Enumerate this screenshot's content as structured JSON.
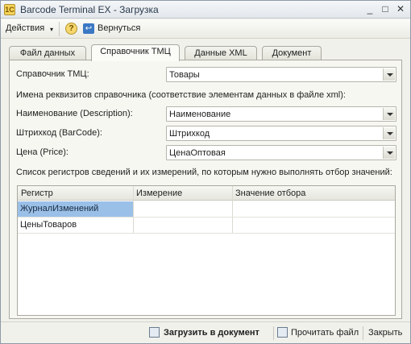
{
  "window": {
    "title": "Barcode Terminal EX - Загрузка",
    "minimize": "_",
    "maximize": "□",
    "close": "✕",
    "app_icon": "1C"
  },
  "toolbar": {
    "actions_label": "Действия",
    "actions_arrow": "▾",
    "help_icon": "?",
    "back_icon": "↩",
    "back_label": "Вернуться"
  },
  "tabs": [
    {
      "label": "Файл данных"
    },
    {
      "label": "Справочник ТМЦ"
    },
    {
      "label": "Данные XML"
    },
    {
      "label": "Документ"
    }
  ],
  "form": {
    "catalog_label": "Справочник ТМЦ:",
    "catalog_value": "Товары",
    "fields_header": "Имена реквизитов справочника (соответствие элементам данных в файле xml):",
    "name_label": "Наименование (Description):",
    "name_value": "Наименование",
    "barcode_label": "Штрихкод (BarCode):",
    "barcode_value": "Штрихкод",
    "price_label": "Цена (Price):",
    "price_value": "ЦенаОптовая",
    "registers_header": "Список регистров сведений и их измерений, по которым нужно выполнять отбор значений:"
  },
  "grid": {
    "columns": [
      "Регистр",
      "Измерение",
      "Значение отбора"
    ],
    "rows": [
      [
        "ЖурналИзменений",
        "",
        ""
      ],
      [
        "ЦеныТоваров",
        "",
        ""
      ]
    ]
  },
  "footer": {
    "load_label": "Загрузить в документ",
    "read_label": "Прочитать файл",
    "close_label": "Закрыть"
  }
}
